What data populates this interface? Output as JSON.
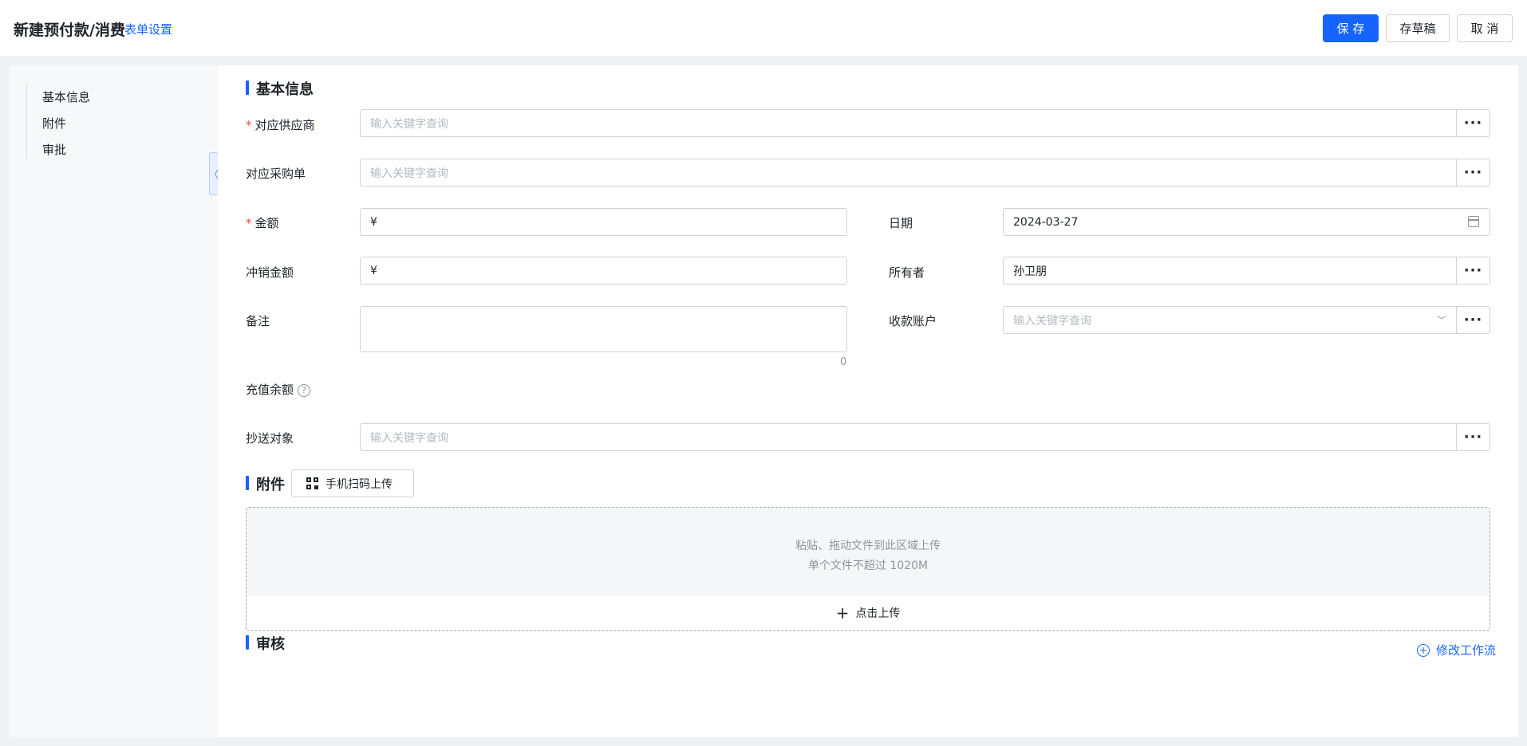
{
  "header": {
    "title": "新建预付款/消费",
    "form_settings": "表单设置",
    "save_label": "保 存",
    "draft_label": "存草稿",
    "cancel_label": "取 消"
  },
  "sidebar": {
    "items": [
      {
        "label": "基本信息"
      },
      {
        "label": "附件"
      },
      {
        "label": "审批"
      }
    ]
  },
  "basic_info": {
    "title": "基本信息",
    "supplier": {
      "label": "对应供应商",
      "required": true,
      "placeholder": "输入关键字查询"
    },
    "purchase_order": {
      "label": "对应采购单",
      "placeholder": "输入关键字查询"
    },
    "amount": {
      "label": "金额",
      "required": true,
      "value": "¥"
    },
    "date": {
      "label": "日期",
      "value": "2024-03-27"
    },
    "writeoff_amount": {
      "label": "冲销金额",
      "value": "¥"
    },
    "owner": {
      "label": "所有者",
      "value": "孙卫朋"
    },
    "remark": {
      "label": "备注",
      "counter": "0"
    },
    "account": {
      "label": "收款账户",
      "placeholder": "输入关键字查询"
    },
    "balance": {
      "label": "充值余额",
      "help": "?"
    },
    "cc": {
      "label": "抄送对象",
      "placeholder": "输入关键字查询"
    }
  },
  "attachments": {
    "title": "附件",
    "scan_upload": "手机扫码上传",
    "drop_hint": "粘贴、拖动文件到此区域上传",
    "size_hint": "单个文件不超过 1020M",
    "upload_label": "点击上传"
  },
  "approval": {
    "title": "审核",
    "edit_workflow": "修改工作流"
  }
}
